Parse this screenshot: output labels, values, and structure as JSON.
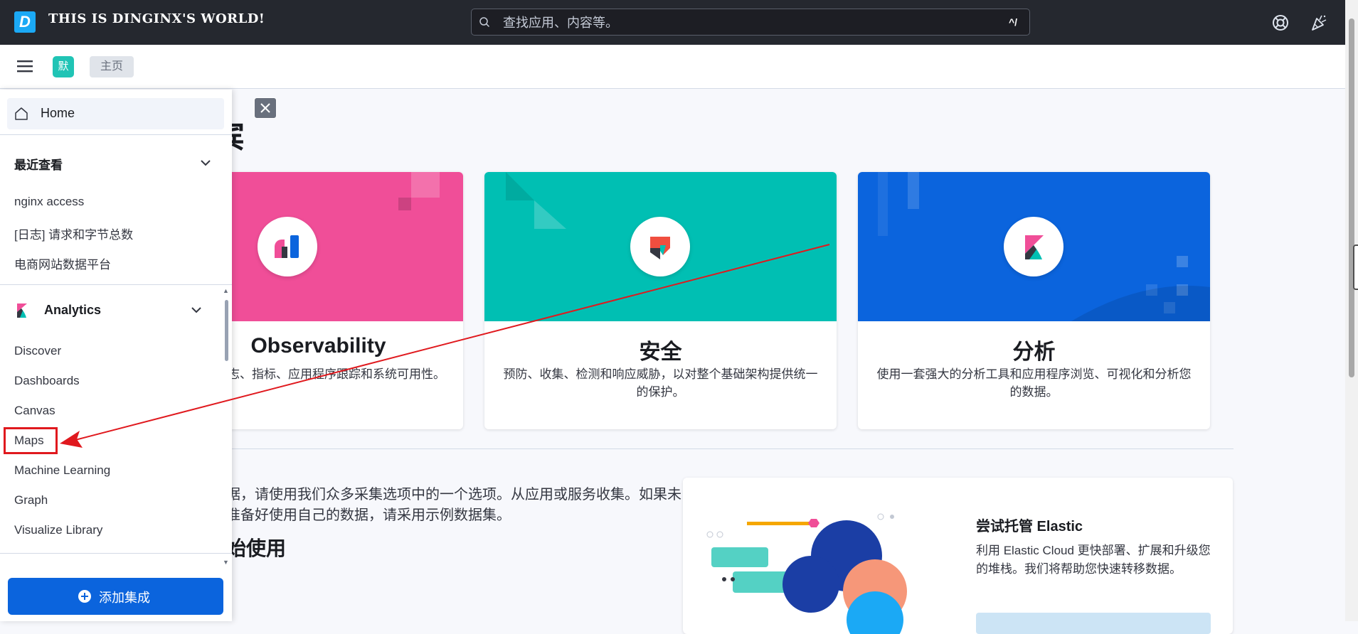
{
  "topbar": {
    "logo_letter": "D",
    "brand_text": "THIS IS DINGINX'S WORLD!",
    "search_placeholder": "查找应用、内容等。",
    "search_shortcut": "^/",
    "icons": [
      "search-icon",
      "help-icon",
      "newsfeed-icon"
    ]
  },
  "header": {
    "space_avatar": "默",
    "breadcrumb": "主页"
  },
  "sidebar": {
    "home_label": "Home",
    "recent_heading": "最近查看",
    "recent_items": [
      "nginx access",
      "[日志] 请求和字节总数",
      "电商网站数据平台"
    ],
    "analytics_heading": "Analytics",
    "analytics_items": [
      "Discover",
      "Dashboards",
      "Canvas",
      "Maps",
      "Machine Learning",
      "Graph",
      "Visualize Library"
    ],
    "add_integration_label": "添加集成"
  },
  "main": {
    "heading_fragment": "宾",
    "cards": [
      {
        "title": "Observability",
        "description": "您的日志、指标、应用程序跟踪和系统可用性。",
        "color": "#f04e98"
      },
      {
        "title": "安全",
        "description": "预防、收集、检测和响应威胁，以对整个基础架构提供统一的保护。",
        "color": "#00bfb3"
      },
      {
        "title": "分析",
        "description": "使用一套强大的分析工具和应用程序浏览、可视化和分析您的数据。",
        "color": "#0077cc"
      }
    ],
    "get_started_heading": "开始使用",
    "get_started_text": "据，请使用我们众多采集选项中的一个选项。从应用或服务收集。如果未准备好使用自己的数据，请采用示例数据集。",
    "cloud": {
      "title": "尝试托管 Elastic",
      "description": "利用 Elastic Cloud 更快部署、扩展和升级您的堆栈。我们将帮助您快速转移数据。"
    }
  },
  "colors": {
    "annotation_red": "#e0191e",
    "primary_button": "#0b64dd"
  }
}
